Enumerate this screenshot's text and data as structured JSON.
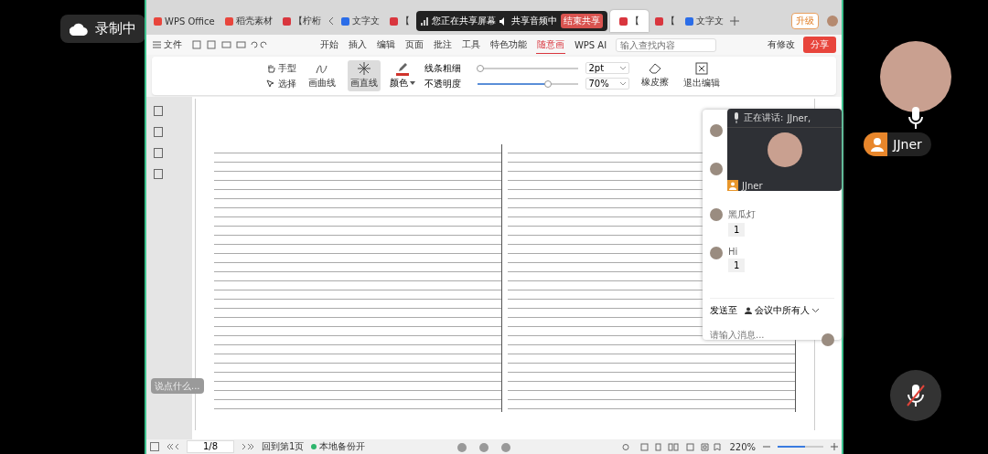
{
  "recording": {
    "label": "录制中"
  },
  "tabs": [
    {
      "label": "WPS Office",
      "kind": "home",
      "selected": false
    },
    {
      "label": "稻壳素材",
      "kind": "doc",
      "selected": false
    },
    {
      "label": "【柠桁",
      "kind": "pdf",
      "selected": false
    },
    {
      "label": "文字文",
      "kind": "word",
      "selected": false
    },
    {
      "label": "【",
      "kind": "pdf",
      "selected": false
    },
    {
      "label": "【",
      "kind": "pdf",
      "selected": true
    },
    {
      "label": "【",
      "kind": "pdf",
      "selected": false
    },
    {
      "label": "文字文",
      "kind": "word",
      "selected": false
    }
  ],
  "share_bar": {
    "status": "您正在共享屏幕",
    "audio": "共享音频中",
    "stop": "结束共享"
  },
  "upgrade": "升级",
  "file_menu": "文件",
  "menu": [
    {
      "label": "开始",
      "selected": false
    },
    {
      "label": "插入",
      "selected": false
    },
    {
      "label": "编辑",
      "selected": false
    },
    {
      "label": "页面",
      "selected": false
    },
    {
      "label": "批注",
      "selected": false
    },
    {
      "label": "工具",
      "selected": false
    },
    {
      "label": "特色功能",
      "selected": false
    },
    {
      "label": "随意画",
      "selected": true
    },
    {
      "label": "WPS AI",
      "selected": false
    }
  ],
  "search": {
    "placeholder": "输入查找内容"
  },
  "modified": "有修改",
  "share": "分享",
  "toolbar": {
    "hand": "手型",
    "select": "选择",
    "modes": [
      {
        "label": "画曲线",
        "kind": "curve",
        "selected": false
      },
      {
        "label": "画直线",
        "kind": "line",
        "selected": true
      }
    ],
    "color": {
      "label": "颜色",
      "color": "#d0342c"
    },
    "thickness": {
      "label": "线条粗细",
      "level": 0.03,
      "value": "2pt"
    },
    "opacity": {
      "label": "不透明度",
      "level": 0.7,
      "value": "70%"
    },
    "eraser": "橡皮擦",
    "exit": "退出编辑"
  },
  "comment_hint": {
    "placeholder": "说点什么..."
  },
  "status_bar": {
    "page": "1/8",
    "back": "回到第1页",
    "backup": "本地备份开",
    "zoom": "220%",
    "zoom_slider": {
      "level": 0.6
    }
  },
  "speaking": {
    "label": "正在讲话:",
    "name": "JJner,",
    "tile_name": "JJner"
  },
  "speaker_name": "JJner",
  "chat": {
    "messages": [
      {
        "name": "黑瓜灯",
        "text": "1"
      },
      {
        "name": "Hi",
        "text": "1"
      }
    ],
    "send_to": "发送至",
    "audience": "会议中所有人",
    "placeholder": "请输入消息..."
  }
}
